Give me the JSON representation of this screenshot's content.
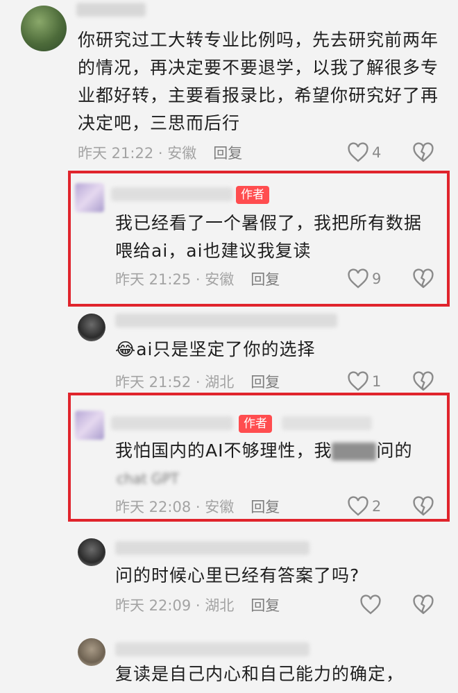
{
  "comments": [
    {
      "text": "你研究过工大转专业比例吗，先去研究前两年的情况，再决定要不要退学，以我了解很多专业都好转，主要看报录比，希望你研究好了再决定吧，三思而后行",
      "time": "昨天 21:22 · 安徽",
      "reply": "回复",
      "likes": "4"
    },
    {
      "badge": "作者",
      "text": "我已经看了一个暑假了，我把所有数据喂给ai，ai也建议我复读",
      "time": "昨天 21:25 · 安徽",
      "reply": "回复",
      "likes": "9"
    },
    {
      "emoji": "😂",
      "text": "ai只是坚定了你的选择",
      "time": "昨天 21:52 · 湖北",
      "reply": "回复",
      "likes": "1"
    },
    {
      "badge": "作者",
      "text_part1": "我怕国内的AI不够理性，我",
      "text_part2": "问的",
      "text_line2": "chat GPT",
      "time": "昨天 22:08 · 安徽",
      "reply": "回复",
      "likes": "2"
    },
    {
      "text": "问的时候心里已经有答案了吗?",
      "time": "昨天 22:09 · 湖北",
      "reply": "回复",
      "likes": ""
    },
    {
      "text": "复读是自己内心和自己能力的确定，"
    }
  ],
  "colors": {
    "highlight_border": "#e0242c",
    "badge": "#ff4d4f"
  }
}
